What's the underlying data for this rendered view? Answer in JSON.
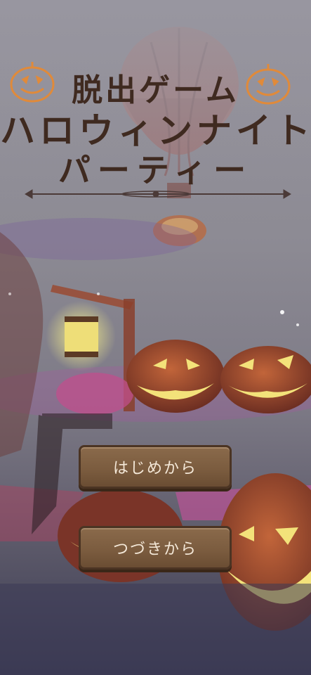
{
  "title": {
    "line1": "脱出ゲーム",
    "line2": "ハロウィンナイト",
    "line3": "パーティー"
  },
  "menu": {
    "start_label": "はじめから",
    "continue_label": "つづきから"
  },
  "colors": {
    "title_text": "#3f2a20",
    "button_face": "#7a5b3e",
    "button_text": "#f4e8d8",
    "pumpkin_orange": "#e08a3a",
    "glow_yellow": "#f3e27a"
  }
}
